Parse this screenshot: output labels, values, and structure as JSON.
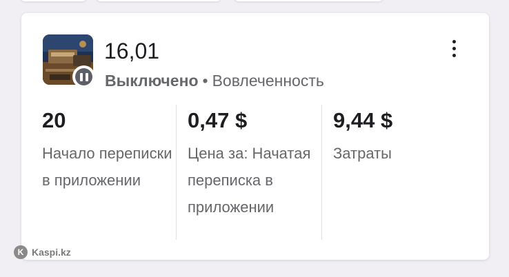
{
  "ad": {
    "title": "16,01",
    "status": "Выключено",
    "separator": "•",
    "objective": "Вовлеченность",
    "thumbnail_icon": "ad-thumbnail-image",
    "status_icon": "pause-icon",
    "menu_icon": "more-vertical-icon"
  },
  "metrics": [
    {
      "value": "20",
      "label": "Начало переписки в приложении"
    },
    {
      "value": "0,47 $",
      "label": "Цена за: Начатая переписка в приложении"
    },
    {
      "value": "9,44 $",
      "label": "Затраты"
    }
  ],
  "watermark": {
    "logo_letter": "K",
    "text": "Kaspi.kz"
  },
  "colors": {
    "background": "#f1eff4",
    "card": "#ffffff",
    "text_primary": "#1c1e21",
    "text_secondary": "#65676b",
    "status_badge": "#5d6167"
  }
}
